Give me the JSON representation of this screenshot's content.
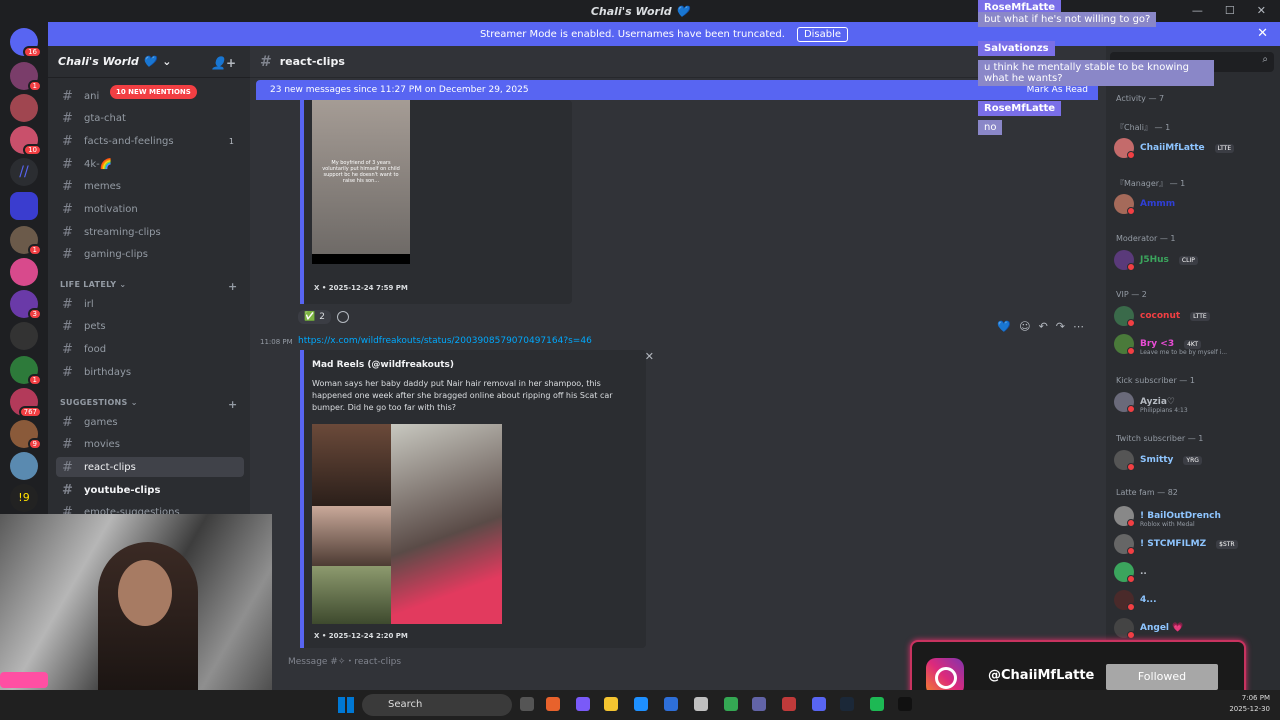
{
  "window": {
    "title": "Chali's World 💙",
    "controls": [
      "—",
      "☐",
      "✕"
    ]
  },
  "banner": {
    "text": "Streamer Mode is enabled. Usernames have been truncated.",
    "button": "Disable"
  },
  "guild": {
    "name": "Chali's World 💙"
  },
  "channels": {
    "mentions_pill": "10 NEW MENTIONS",
    "items": [
      {
        "label": "ani"
      },
      {
        "label": "gta-chat"
      },
      {
        "label": "facts-and-feelings",
        "count": "1"
      },
      {
        "label": "4k-🌈"
      },
      {
        "label": "memes"
      },
      {
        "label": "motivation"
      },
      {
        "label": "streaming-clips"
      },
      {
        "label": "gaming-clips"
      },
      {
        "label": "irl"
      },
      {
        "label": "pets"
      },
      {
        "label": "food"
      },
      {
        "label": "birthdays"
      },
      {
        "label": "games"
      },
      {
        "label": "movies"
      },
      {
        "label": "react-clips"
      },
      {
        "label": "youtube-clips"
      },
      {
        "label": "emote-suggestions"
      }
    ],
    "categories": [
      "LIFE LATELY",
      "SUGGESTIONS"
    ]
  },
  "chat": {
    "channel": "react-clips",
    "new_messages": "23 new messages since 11:27 PM on December 29, 2025",
    "mark_read": "Mark As Read",
    "embed1": {
      "thumb_text": "My boyfriend of 3 years voluntarily put himself on child support bc he doesn't want to raise his son...",
      "footer": "X • 2025-12-24 7:59 PM"
    },
    "reaction": {
      "emoji": "✅",
      "count": "2"
    },
    "msg2": {
      "time": "11:08 PM",
      "link": "https://x.com/wildfreakouts/status/2003908579070497164?s=46",
      "author": "Mad Reels (@wildfreakouts)",
      "desc": "Woman says her baby daddy put Nair hair removal in her shampoo, this happened one week after she bragged online about ripping off his Scat car bumper. Did he go too far with this?",
      "footer": "X • 2025-12-24 2:20 PM"
    },
    "input_placeholder": "Message #✧・react-clips"
  },
  "members": {
    "activity": "Activity — 7",
    "groups": [
      {
        "cat": "『Chali』 — 1",
        "members": [
          {
            "name": "ChaiiMfLatte",
            "tag": "LTTE",
            "color": "#8ec5ff"
          }
        ]
      },
      {
        "cat": "『Manager』 — 1",
        "members": [
          {
            "name": "Ammm",
            "tag": "",
            "color": "#2f3fd6"
          }
        ]
      },
      {
        "cat": "Moderator — 1",
        "members": [
          {
            "name": "J5Hus",
            "tag": "CLIP",
            "color": "#3ba55d"
          }
        ]
      },
      {
        "cat": "VIP — 2",
        "members": [
          {
            "name": "coconut",
            "tag": "LTTE",
            "color": "#f23f43"
          },
          {
            "name": "Bry <3",
            "tag": "4KT",
            "color": "#e94cd6",
            "sub": "Leave me to be by myself i..."
          }
        ]
      },
      {
        "cat": "Kick subscriber — 1",
        "members": [
          {
            "name": "Ayzia♡",
            "tag": "",
            "color": "#b5bac1",
            "sub": "Philippians 4:13"
          }
        ]
      },
      {
        "cat": "Twitch subscriber — 1",
        "members": [
          {
            "name": "Smitty",
            "tag": "YRG",
            "color": "#8ec5ff"
          }
        ]
      },
      {
        "cat": "Latte fam — 82",
        "members": [
          {
            "name": "! BailOutDrench",
            "tag": "",
            "color": "#8ec5ff",
            "sub": "Roblox with Medal"
          },
          {
            "name": "! STCMFILMZ",
            "tag": "$STR",
            "color": "#8ec5ff"
          },
          {
            "name": "..",
            "tag": "",
            "color": "#b5bac1"
          },
          {
            "name": "4...",
            "tag": "",
            "color": "#8ec5ff"
          },
          {
            "name": "Angel 💗",
            "tag": "",
            "color": "#8ec5ff"
          }
        ]
      }
    ]
  },
  "overlay_chat": [
    {
      "user": "RoseMfLatte",
      "msg": "but what if he's not willing to go?"
    },
    {
      "user": "Salvationzs",
      "msg": "u think he mentally stable to be knowing what he wants?"
    },
    {
      "user": "RoseMfLatte",
      "msg": "no"
    }
  ],
  "instagram": {
    "handle": "@ChaiiMfLatte",
    "button": "Followed"
  },
  "taskbar": {
    "search": "Search",
    "time": "7:06 PM",
    "date": "2025-12-30"
  }
}
